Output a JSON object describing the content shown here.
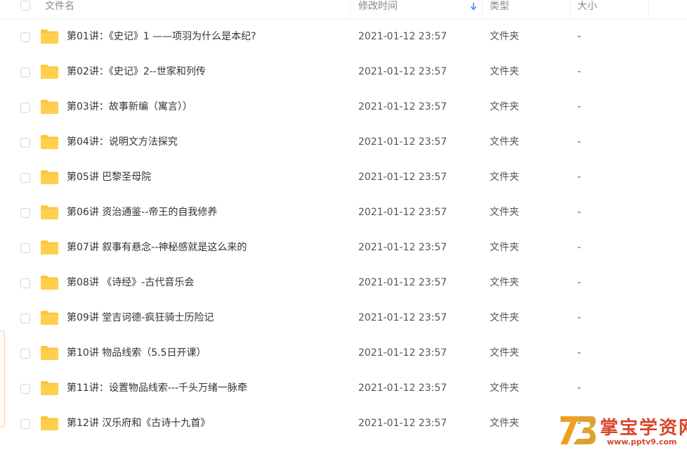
{
  "header": {
    "name_label": "文件名",
    "time_label": "修改时间",
    "type_label": "类型",
    "size_label": "大小",
    "sort_icon": "arrow-down-icon"
  },
  "files": [
    {
      "name": "第01讲：《史记》1 ——项羽为什么是本纪?",
      "time": "2021-01-12 23:57",
      "type": "文件夹",
      "size": "-"
    },
    {
      "name": "第02讲：《史记》2--世家和列传",
      "time": "2021-01-12 23:57",
      "type": "文件夹",
      "size": "-"
    },
    {
      "name": "第03讲：故事新编（寓言））",
      "time": "2021-01-12 23:57",
      "type": "文件夹",
      "size": "-"
    },
    {
      "name": "第04讲：说明文方法探究",
      "time": "2021-01-12 23:57",
      "type": "文件夹",
      "size": "-"
    },
    {
      "name": "第05讲 巴黎圣母院",
      "time": "2021-01-12 23:57",
      "type": "文件夹",
      "size": "-"
    },
    {
      "name": "第06讲 资治通鉴--帝王的自我修养",
      "time": "2021-01-12 23:57",
      "type": "文件夹",
      "size": "-"
    },
    {
      "name": "第07讲 叙事有悬念--神秘感就是这么来的",
      "time": "2021-01-12 23:57",
      "type": "文件夹",
      "size": "-"
    },
    {
      "name": "第08讲 《诗经》-古代音乐会",
      "time": "2021-01-12 23:57",
      "type": "文件夹",
      "size": "-"
    },
    {
      "name": "第09讲 堂吉诃德-疯狂骑士历险记",
      "time": "2021-01-12 23:57",
      "type": "文件夹",
      "size": "-"
    },
    {
      "name": "第10讲 物品线索（5.5日开课）",
      "time": "2021-01-12 23:57",
      "type": "文件夹",
      "size": "-"
    },
    {
      "name": "第11讲：设置物品线索---千头万绪一脉牵",
      "time": "2021-01-12 23:57",
      "type": "文件夹",
      "size": "-"
    },
    {
      "name": "第12讲 汉乐府和《古诗十九首》",
      "time": "2021-01-12 23:57",
      "type": "文件夹",
      "size": "-"
    }
  ],
  "watermark": {
    "title": "掌宝学资网",
    "url": "www.pptv9.com"
  },
  "colors": {
    "folder": "#ffc53d",
    "sort_arrow": "#3b8cff",
    "watermark": "#d9462b"
  }
}
